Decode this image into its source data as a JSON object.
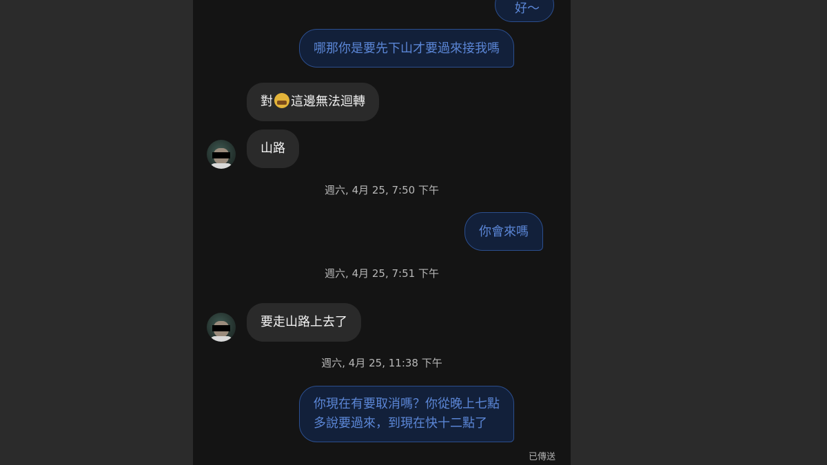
{
  "conversation": {
    "messages": [
      {
        "from": "me",
        "text": "好～"
      },
      {
        "from": "me",
        "text": "哪那你是要先下山才要過來接我嗎"
      },
      {
        "from": "them",
        "text_before": "對",
        "emoji": "grimacing-face-emoji",
        "text_after": "這邊無法迴轉"
      },
      {
        "from": "them",
        "text": "山路"
      },
      {
        "from": "me",
        "text": "你會來嗎"
      },
      {
        "from": "them",
        "text": "要走山路上去了"
      },
      {
        "from": "me",
        "lines": [
          "你現在有要取消嗎？你從晚上七點",
          "多說要過來，到現在快十二點了"
        ]
      }
    ],
    "timestamps": [
      "週六, 4月 25, 7:50 下午",
      "週六, 4月 25, 7:51 下午",
      "週六, 4月 25, 11:38 下午"
    ],
    "status": "已傳送"
  },
  "colors": {
    "background": "#141414",
    "outgoing_bubble": "#12203a",
    "outgoing_text": "#5b86d6",
    "incoming_bubble": "#2a2a2a",
    "incoming_text": "#f2f2f2"
  }
}
